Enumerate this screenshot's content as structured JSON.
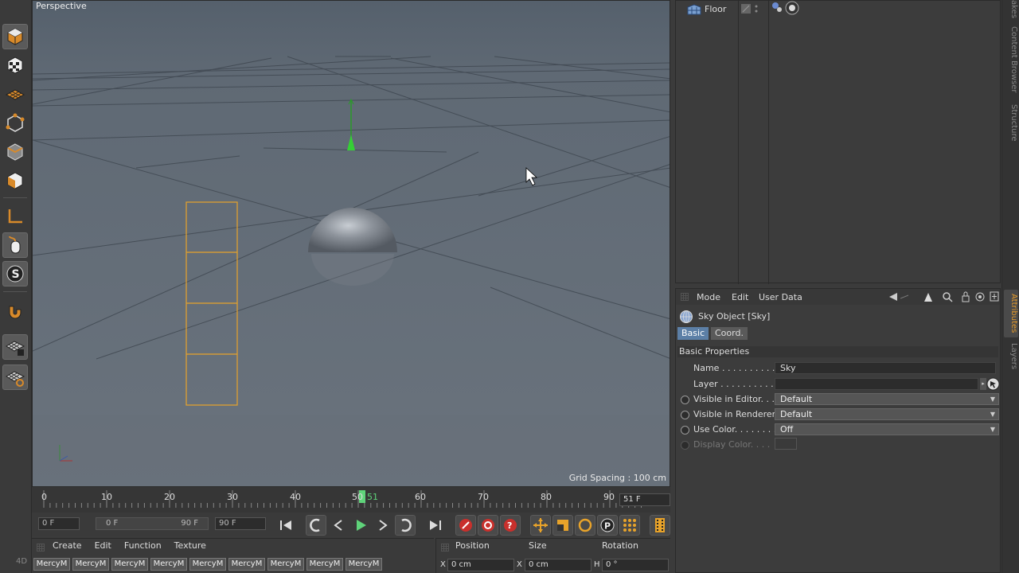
{
  "viewport": {
    "label": "Perspective",
    "grid_spacing": "Grid Spacing : 100 cm"
  },
  "left_toolbar": {
    "tools": [
      {
        "name": "model-mode-icon"
      },
      {
        "name": "texture-mode-icon"
      },
      {
        "name": "workplane-mode-icon"
      },
      {
        "name": "points-mode-icon"
      },
      {
        "name": "edges-mode-icon"
      },
      {
        "name": "polygons-mode-icon"
      },
      {
        "name": "axis-mode-icon"
      },
      {
        "name": "tweak-mode-icon"
      },
      {
        "name": "snap-icon"
      },
      {
        "name": "magnet-icon"
      },
      {
        "name": "workplane-lock-icon"
      },
      {
        "name": "workplane-snap-icon"
      }
    ],
    "footer": "4D"
  },
  "timeline": {
    "ticks": [
      "0",
      "10",
      "20",
      "30",
      "40",
      "50",
      "60",
      "70",
      "80",
      "90"
    ],
    "current_marker": "51",
    "current_frame": "51 F"
  },
  "transport": {
    "start_field": "0 F",
    "range_start": "0 F",
    "range_end": "90 F",
    "end_field": "90 F"
  },
  "material_manager": {
    "menu": [
      "Create",
      "Edit",
      "Function",
      "Texture"
    ],
    "materials": [
      "MercyM",
      "MercyM",
      "MercyM",
      "MercyM",
      "MercyM",
      "MercyM",
      "MercyM",
      "MercyM",
      "MercyM"
    ]
  },
  "coordinates": {
    "headers": [
      "Position",
      "Size",
      "Rotation"
    ],
    "x_label": "X",
    "x_pos": "0 cm",
    "x2_label": "X",
    "x_size": "0 cm",
    "h_label": "H",
    "h_rot": "0 °"
  },
  "object_manager": {
    "object_name": "Floor"
  },
  "side_tabs": [
    "akes",
    "Content Browser",
    "Structure",
    "Attributes",
    "Layers"
  ],
  "attributes": {
    "menu": [
      "Mode",
      "Edit",
      "User Data"
    ],
    "title": "Sky Object [Sky]",
    "tabs": [
      "Basic",
      "Coord."
    ],
    "section": "Basic Properties",
    "name_label": "Name . . . . . . . . . . . . .",
    "name_value": "Sky",
    "layer_label": "Layer . . . . . . . . . . . . .",
    "vis_editor_label": "Visible in Editor. . .",
    "vis_editor_value": "Default",
    "vis_render_label": "Visible in Renderer",
    "vis_render_value": "Default",
    "use_color_label": "Use Color. . . . . . . . .",
    "use_color_value": "Off",
    "display_color_label": "Display Color. . . ."
  }
}
